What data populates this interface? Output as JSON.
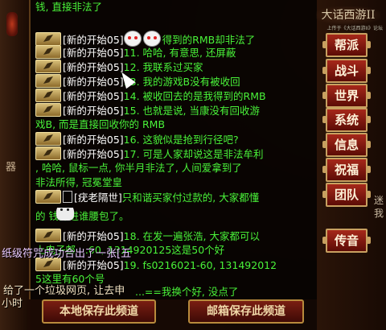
{
  "left_fragments": {
    "top": "器",
    "bottom": ""
  },
  "chat": {
    "lines": [
      {
        "prefix": "",
        "name": "",
        "text": "钱, 直接非法了"
      },
      {
        "prefix": "[新的开始05]",
        "name": "",
        "text": "得到的RMB却非法了",
        "emoji": true
      },
      {
        "prefix": "[新的开始05]",
        "text": "11. 哈哈, 有意思, 还屏蔽"
      },
      {
        "prefix": "[新的开始05]",
        "text": "12. 我联系过买家"
      },
      {
        "prefix": "[新的开始05]",
        "text": "13. 我的游戏B没有被收回"
      },
      {
        "prefix": "[新的开始05]",
        "text": "14. 被收回去的是我得到的RMB"
      },
      {
        "prefix": "[新的开始05]",
        "text": "15. 也就是说, 当康没有回收游"
      },
      {
        "prefix": "",
        "text": "戏B, 而是直接回收你的 RMB"
      },
      {
        "prefix": "[新的开始05]",
        "text": "16. 这貌似是抢到行径吧?"
      },
      {
        "prefix": "[新的开始05]",
        "text": "17. 可是人家却说这是非法牟利"
      },
      {
        "prefix": "",
        "text": ", 哈哈, 鼠标一点, 你半月非法了, 人间爱拿到了"
      },
      {
        "prefix": "",
        "text": "非法所得, 冠冕堂皇"
      },
      {
        "prefix": "[疣老隔世]",
        "text": "只和谐买家付过款的, 大家都懂"
      },
      {
        "prefix": "",
        "text": "的     钱都进谁腰包了。"
      },
      {
        "prefix": "[新的开始05]",
        "text": "18. 在发一遍张浩, 大家都可以"
      },
      {
        "prefix": "",
        "text": "上电子邮  ...60, 1314920125这是50个好"
      },
      {
        "prefix": "[新的开始05]",
        "text": "19. fs0216021-60, 131492012"
      },
      {
        "prefix": "",
        "text": "5这里有60个号"
      },
      {
        "prefix": "",
        "text": "...==我换个好, 没点了"
      }
    ]
  },
  "system_messages": {
    "msg1": "纸级符咒成功合出了一张[五",
    "msg2": "给了一个垃圾网页, 让去申",
    "msg3": "小时"
  },
  "buttons": {
    "save_local": "本地保存此频道",
    "save_mail": "邮箱保存此频道"
  },
  "logo": {
    "text": "大话西游II",
    "sub": "上传于《大话西游II》论坛"
  },
  "menu": [
    "帮派",
    "战斗",
    "世界",
    "系统",
    "信息",
    "祝福",
    "团队",
    "传音"
  ],
  "right_fragments": [
    "迷",
    "我"
  ]
}
